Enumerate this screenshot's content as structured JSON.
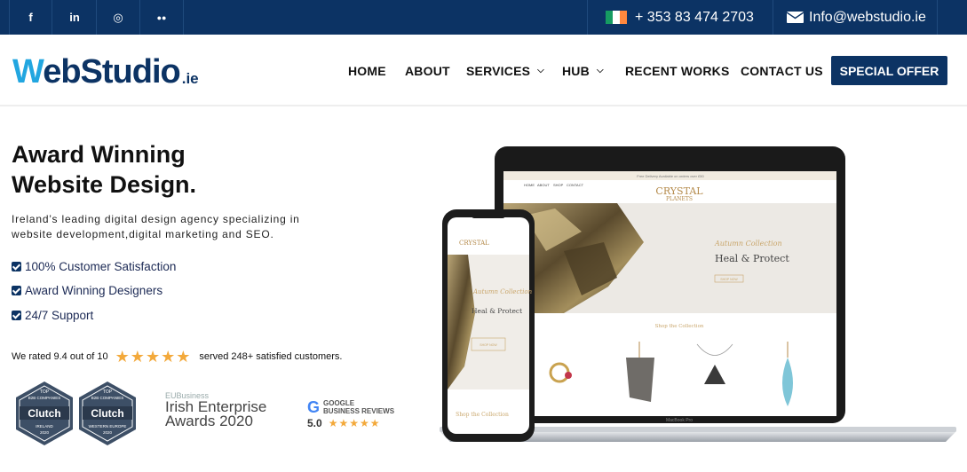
{
  "topbar": {
    "social": [
      {
        "name": "facebook-icon",
        "glyph": "f"
      },
      {
        "name": "linkedin-icon",
        "glyph": "in"
      },
      {
        "name": "instagram-icon",
        "glyph": "◎"
      },
      {
        "name": "flickr-icon",
        "glyph": "●●"
      }
    ],
    "phone": "+ 353 83 474 2703",
    "email": "Info@webstudio.ie"
  },
  "header": {
    "logo_w": "W",
    "logo_rest": "ebStudio",
    "logo_tld": ".ie",
    "nav": {
      "home": "HOME",
      "about": "ABOUT",
      "services": "SERVICES",
      "hub": "HUB",
      "recent_works": "RECENT WORKS",
      "contact_us": "CONTACT US"
    },
    "special_offer": "SPECIAL OFFER"
  },
  "hero": {
    "title_line1": "Award Winning",
    "title_line2": "Website Design.",
    "subtitle_line1": "Ireland’s leading digital design agency specializing in",
    "subtitle_line2": "website development,digital marketing and SEO.",
    "checks": [
      "100% Customer Satisfaction",
      "Award Winning Designers",
      "24/7 Support"
    ],
    "rating_prefix": "We rated 9.4 out of 10",
    "rating_stars": 5,
    "rating_suffix": "served 248+ satisfied customers."
  },
  "badges": {
    "clutch1": {
      "top": "TOP",
      "sub": "B2B COMPANIES",
      "brand": "Clutch",
      "region": "IRELAND",
      "year": "2020"
    },
    "clutch2": {
      "top": "TOP",
      "sub": "B2B COMPANIES",
      "brand": "Clutch",
      "region": "WESTERN EUROPE",
      "year": "2020"
    },
    "irish_enterprise": {
      "small": "EUBusiness",
      "line1": "Irish Enterprise",
      "line2": "Awards 2020"
    },
    "google": {
      "g": "G",
      "line1": "GOOGLE",
      "line2": "BUSINESS REVIEWS",
      "score": "5.0"
    }
  },
  "mockup": {
    "site_topbar": "Free Delivery Available on orders over £50",
    "site_menu": [
      "HOME",
      "ABOUT",
      "SHOP",
      "CONTACT"
    ],
    "site_logo_1": "CRYSTAL",
    "site_logo_2": "PLANETS",
    "autumn": "Autumn Collection",
    "heal": "Heal & Protect",
    "shop_now": "SHOP NOW",
    "shop_collection": "Shop the Collection",
    "laptop_label": "MacBook Pro",
    "phone_shop": "Shop the Collection"
  },
  "colors": {
    "navy": "#0c3364",
    "accent": "#22a6e0",
    "star": "#f3a93b"
  }
}
